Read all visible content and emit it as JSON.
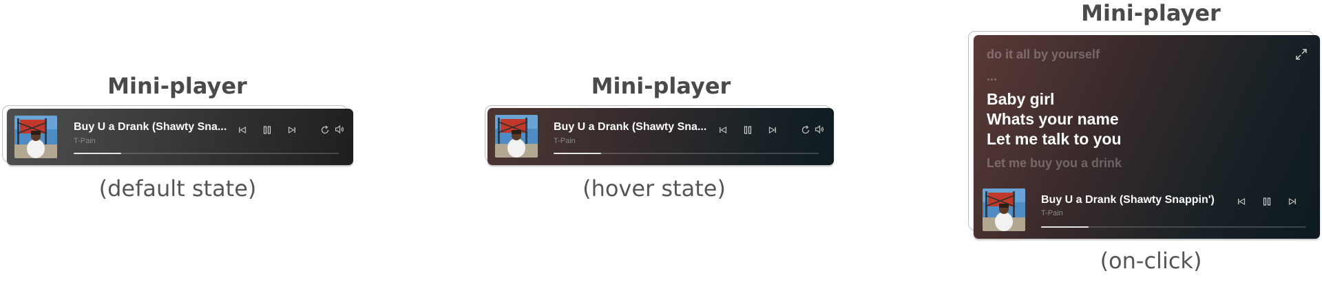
{
  "variants": [
    {
      "heading": "Mini-player",
      "caption": "(default state)"
    },
    {
      "heading": "Mini-player",
      "caption": "(hover state)"
    },
    {
      "heading": "Mini-player",
      "caption": "(on-click)"
    }
  ],
  "track": {
    "title_truncated": "Buy U a Drank (Shawty Sna...",
    "title_full": "Buy U a Drank (Shawty Snappin')",
    "artist": "T-Pain",
    "progress": 0.18
  },
  "lyrics": {
    "previous": [
      "do it all by yourself",
      "..."
    ],
    "current": [
      "Baby girl",
      "Whats your name",
      "Let me talk to you"
    ],
    "next": "Let me buy you a drink"
  },
  "icons": {
    "previous": "skip-previous-icon",
    "pause": "pause-icon",
    "next": "skip-next-icon",
    "repeat": "repeat-icon",
    "volume": "volume-icon",
    "expand": "expand-icon"
  },
  "colors": {
    "default_bg": "#3a3a3a",
    "hover_bg": "#1b2327",
    "accent_text": "#ffffff",
    "muted_text": "#8a8a8a"
  }
}
